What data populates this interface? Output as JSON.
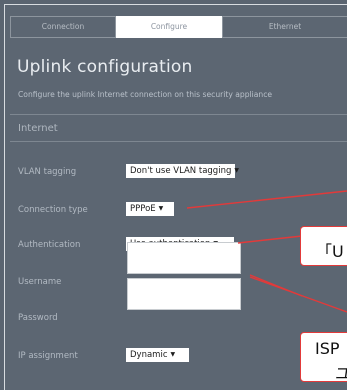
{
  "tabs": [
    {
      "label": "Connection",
      "active": false
    },
    {
      "label": "Configure",
      "active": true
    },
    {
      "label": "Ethernet",
      "active": false
    }
  ],
  "page_title": "Uplink configuration",
  "description": "Configure the uplink Internet connection on this security appliance",
  "section_title": "Internet",
  "fields": {
    "vlan": {
      "label": "VLAN tagging",
      "value": "Don't use VLAN tagging"
    },
    "connection_type": {
      "label": "Connection type",
      "value": "PPPoE"
    },
    "authentication": {
      "label": "Authentication",
      "value": "Use authentication"
    },
    "username": {
      "label": "Username",
      "value": ""
    },
    "password": {
      "label": "Password",
      "value": ""
    },
    "ip_assignment": {
      "label": "IP assignment",
      "value": "Dynamic"
    }
  },
  "callouts": {
    "authentication_note": "「U",
    "isp_note_line1": "ISP",
    "isp_note_line2": "ユ"
  },
  "colors": {
    "background": "#5c6672",
    "callout_border": "#e23a3a"
  },
  "icons": {
    "dropdown": "chevron-down-icon"
  }
}
